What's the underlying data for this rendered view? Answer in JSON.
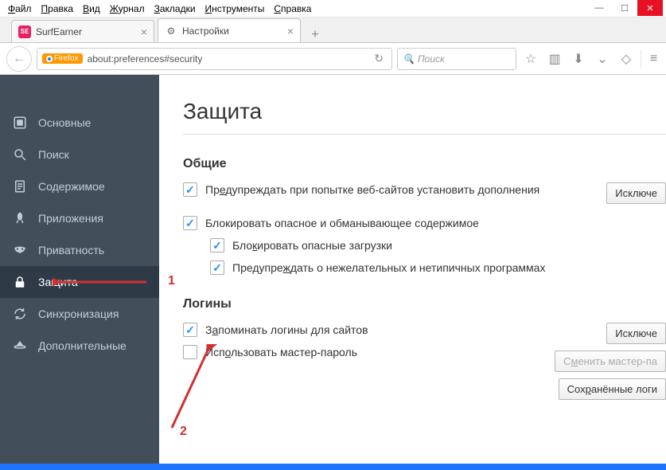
{
  "menubar": [
    "Файл",
    "Правка",
    "Вид",
    "Журнал",
    "Закладки",
    "Инструменты",
    "Справка"
  ],
  "tabs": [
    {
      "label": "SurfEarner",
      "active": false
    },
    {
      "label": "Настройки",
      "active": true
    }
  ],
  "urlbar": {
    "badge": "Firefox",
    "url": "about:preferences#security"
  },
  "searchbar": {
    "placeholder": "Поиск"
  },
  "sidebar": {
    "items": [
      {
        "label": "Основные"
      },
      {
        "label": "Поиск"
      },
      {
        "label": "Содержимое"
      },
      {
        "label": "Приложения"
      },
      {
        "label": "Приватность"
      },
      {
        "label": "Защита"
      },
      {
        "label": "Синхронизация"
      },
      {
        "label": "Дополнительные"
      }
    ],
    "active": 5
  },
  "page": {
    "title": "Защита",
    "sections": {
      "general": {
        "heading": "Общие",
        "opt1": "Предупреждать при попытке веб-сайтов установить дополнения",
        "opt2": "Блокировать опасное и обманывающее содержимое",
        "opt2a": "Блокировать опасные загрузки",
        "opt2b": "Предупреждать о нежелательных и нетипичных программах",
        "btn_exceptions": "Исключе"
      },
      "logins": {
        "heading": "Логины",
        "opt1": "Запоминать логины для сайтов",
        "opt2": "Использовать мастер-пароль",
        "btn_exceptions": "Исключе",
        "btn_change_master": "Сменить мастер-па",
        "btn_saved": "Сохранённые логи"
      }
    }
  },
  "annotations": {
    "n1": "1",
    "n2": "2"
  }
}
